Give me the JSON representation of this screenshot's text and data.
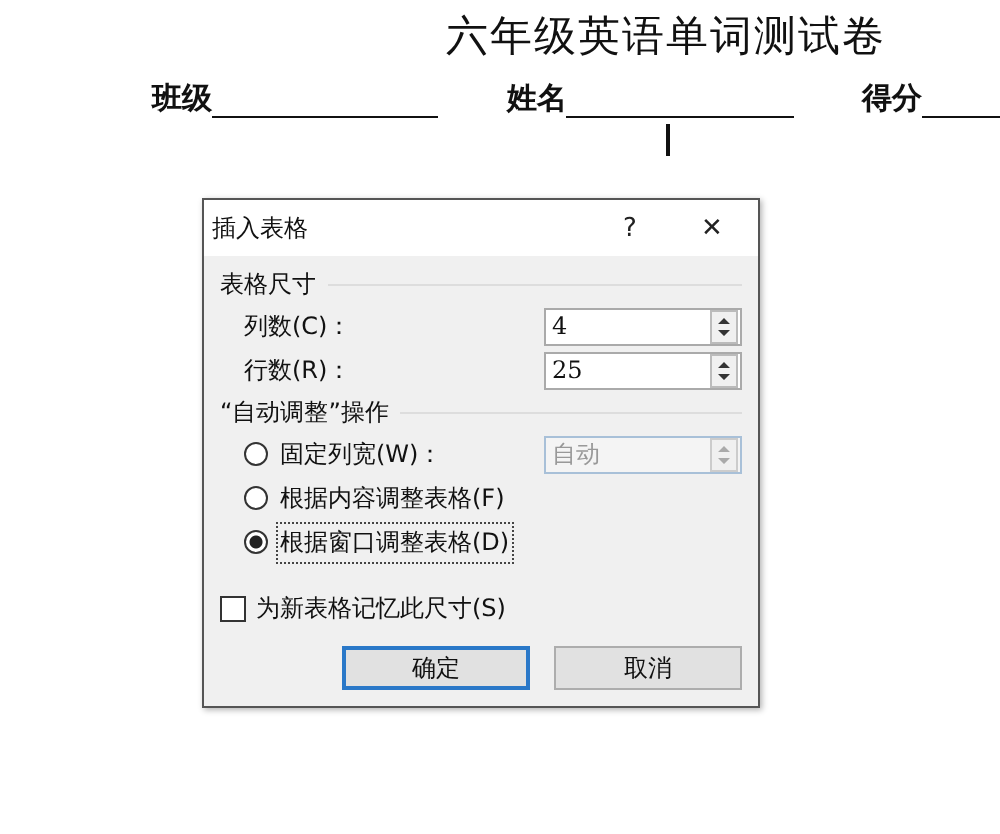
{
  "document": {
    "title": "六年级英语单词测试卷",
    "fields": [
      {
        "label": "班级"
      },
      {
        "label": "姓名"
      },
      {
        "label": "得分"
      }
    ]
  },
  "dialog": {
    "title": "插入表格",
    "help": "?",
    "close": "✕",
    "size_group": {
      "label": "表格尺寸",
      "spinners": [
        {
          "label": "列数(C)：",
          "value": "4",
          "disabled": false
        },
        {
          "label": "行数(R)：",
          "value": "25",
          "disabled": false
        }
      ]
    },
    "autofit_group": {
      "label": "“自动调整”操作",
      "options": [
        {
          "label": "固定列宽(W)：",
          "selected": false,
          "field": {
            "value": "自动",
            "disabled": true
          }
        },
        {
          "label": "根据内容调整表格(F)",
          "selected": false
        },
        {
          "label": "根据窗口调整表格(D)",
          "selected": true
        }
      ]
    },
    "remember": {
      "label": "为新表格记忆此尺寸(S)",
      "checked": false
    },
    "buttons": [
      {
        "label": "确定",
        "default": true
      },
      {
        "label": "取消",
        "default": false
      }
    ]
  }
}
